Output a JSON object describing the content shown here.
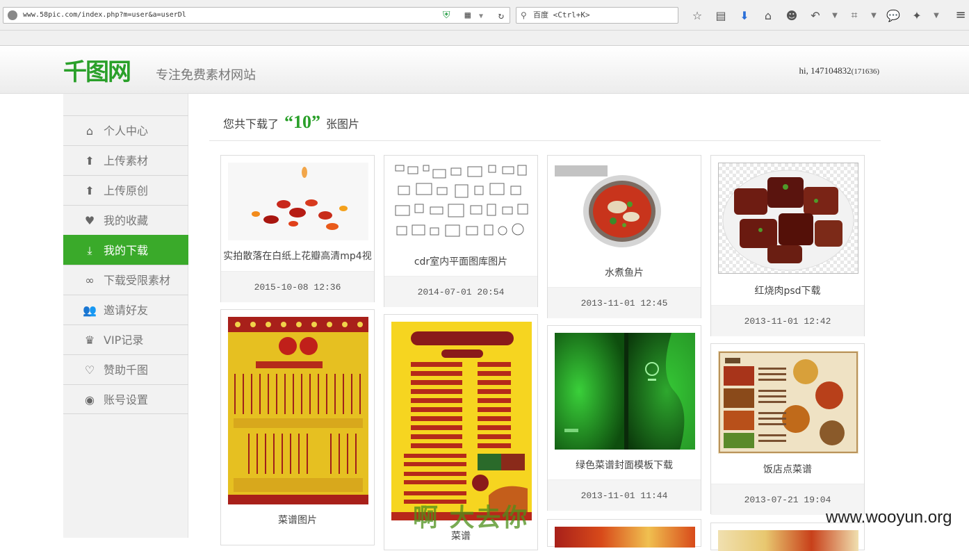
{
  "browser": {
    "url": "www.58pic.com/index.php?m=user&a=userDl",
    "search_placeholder": "百度 <Ctrl+K>",
    "icons": [
      "star-icon",
      "reading-list-icon",
      "download-arrow-icon",
      "home-icon",
      "smiley-icon",
      "undo-icon",
      "chevron-down-icon",
      "crop-icon",
      "chevron-down-icon",
      "chat-icon",
      "plugin-icon",
      "chevron-down-icon"
    ]
  },
  "site": {
    "logo": "千图网",
    "tagline": "专注免费素材网站",
    "greeting": "hi, 147104832",
    "greeting_id": "(171636)"
  },
  "sidebar": {
    "items": [
      {
        "label": "个人中心",
        "icon": "home-icon"
      },
      {
        "label": "上传素材",
        "icon": "upload-icon"
      },
      {
        "label": "上传原创",
        "icon": "upload-original-icon"
      },
      {
        "label": "我的收藏",
        "icon": "heart-icon"
      },
      {
        "label": "我的下载",
        "icon": "download-icon",
        "active": true
      },
      {
        "label": "下载受限素材",
        "icon": "link-icon"
      },
      {
        "label": "邀请好友",
        "icon": "friends-icon"
      },
      {
        "label": "VIP记录",
        "icon": "crown-icon"
      },
      {
        "label": "赞助千图",
        "icon": "sponsor-heart-icon"
      },
      {
        "label": "账号设置",
        "icon": "account-icon"
      }
    ]
  },
  "main": {
    "summary_prefix": "您共下载了",
    "summary_count": "“10”",
    "summary_suffix": "张图片",
    "cards": [
      {
        "title": "实拍散落在白纸上花瓣高清mp4视",
        "date": "2015-10-08 12:36"
      },
      {
        "title": "cdr室内平面图库图片",
        "date": "2014-07-01 20:54"
      },
      {
        "title": "水煮鱼片",
        "date": "2013-11-01 12:45"
      },
      {
        "title": "红烧肉psd下载",
        "date": "2013-11-01 12:42"
      },
      {
        "title": "菜谱图片",
        "date": ""
      },
      {
        "title": "菜谱",
        "date": ""
      },
      {
        "title": "绿色菜谱封面模板下载",
        "date": "2013-11-01 11:44"
      },
      {
        "title": "饭店点菜谱",
        "date": "2013-07-21 19:04"
      }
    ]
  },
  "watermarks": {
    "cn": "啊 大去你",
    "url": "www.wooyun.org"
  },
  "colors": {
    "brand_green": "#3aaa2a",
    "sidebar_bg": "#f2f2f2"
  }
}
